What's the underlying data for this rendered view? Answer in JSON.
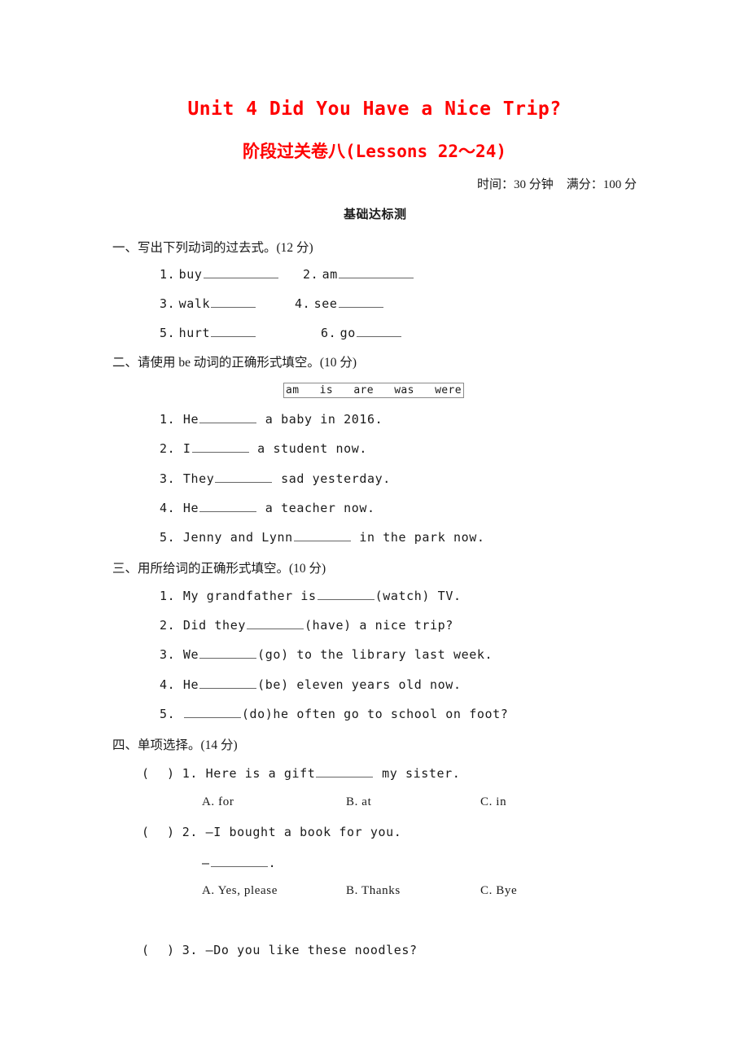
{
  "title": {
    "main": "Unit 4 Did You Have a Nice Trip?",
    "sub": "阶段过关卷八(Lessons 22～24)"
  },
  "meta": {
    "time": "时间：30 分钟",
    "score": "满分：100 分"
  },
  "part_heading": "基础达标测",
  "sections": [
    {
      "heading": "一、写出下列动词的过去式。(12 分)",
      "items": [
        {
          "num": "1.",
          "text": "buy"
        },
        {
          "num": "2.",
          "text": "am"
        },
        {
          "num": "3.",
          "text": "walk"
        },
        {
          "num": "4.",
          "text": "see"
        },
        {
          "num": "5.",
          "text": "hurt"
        },
        {
          "num": "6.",
          "text": "go"
        }
      ]
    },
    {
      "heading": "二、请使用 be 动词的正确形式填空。(10 分)",
      "wordbank": [
        "am",
        "is",
        "are",
        "was",
        "were"
      ],
      "items": [
        {
          "num": "1.",
          "pre": "He",
          "post": " a baby in 2016."
        },
        {
          "num": "2.",
          "pre": "I",
          "post": " a student now."
        },
        {
          "num": "3.",
          "pre": "They",
          "post": " sad yesterday."
        },
        {
          "num": "4.",
          "pre": "He",
          "post": " a teacher now."
        },
        {
          "num": "5.",
          "pre": "Jenny and Lynn",
          "post": " in the park now."
        }
      ]
    },
    {
      "heading": "三、用所给词的正确形式填空。(10 分)",
      "items": [
        {
          "num": "1.",
          "pre": "My grandfather is",
          "post": "(watch) TV."
        },
        {
          "num": "2.",
          "pre": "Did they",
          "post": "(have) a nice trip?"
        },
        {
          "num": "3.",
          "pre": "We",
          "post": "(go) to the library last week."
        },
        {
          "num": "4.",
          "pre": "He",
          "post": "(be) eleven years old now."
        },
        {
          "num": "5.",
          "pre": "",
          "post": "(do)he often go to school on foot?"
        }
      ]
    },
    {
      "heading": "四、单项选择。(14 分)",
      "questions": [
        {
          "num": "1.",
          "stem_pre": "Here is a gift",
          "stem_post": " my sister.",
          "options": [
            "A. for",
            "B. at",
            "C. in"
          ]
        },
        {
          "num": "2.",
          "stem_pre": "—I bought a book for you.",
          "stem_post": "",
          "answer_line": "—",
          "answer_tail": ".",
          "options": [
            "A. Yes, please",
            "B. Thanks",
            "C. Bye"
          ]
        },
        {
          "num": "3.",
          "stem_pre": "—Do you like these noodles?",
          "stem_post": "",
          "options": []
        }
      ]
    }
  ]
}
